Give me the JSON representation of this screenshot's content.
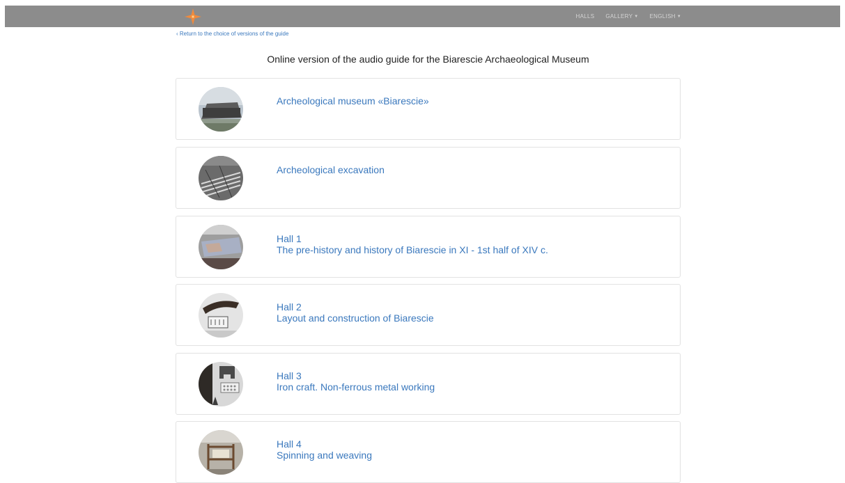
{
  "nav": {
    "logo_icon": "cross-star-logo",
    "items": [
      {
        "label": "HALLS",
        "dropdown": false
      },
      {
        "label": "GALLERY",
        "dropdown": true
      },
      {
        "label": "ENGLISH",
        "dropdown": true
      }
    ]
  },
  "back_link": "‹ Return to the choice of versions of the guide",
  "page_title": "Online version of the audio guide for the Biarescie Archaeological Museum",
  "cards": [
    {
      "line1": "Archeological museum «Biarescie»",
      "line2": ""
    },
    {
      "line1": "Archeological excavation",
      "line2": ""
    },
    {
      "line1": "Hall 1",
      "line2": "The pre-history and history of Biarescie in XI - 1st half of XIV c."
    },
    {
      "line1": "Hall 2",
      "line2": "Layout and construction of Biarescie"
    },
    {
      "line1": "Hall 3",
      "line2": "Iron craft. Non-ferrous metal working"
    },
    {
      "line1": "Hall 4",
      "line2": "Spinning and weaving"
    }
  ],
  "colors": {
    "navbar_bg": "#8c8c8c",
    "link": "#3a78bd",
    "logo": "#f08a3c"
  }
}
